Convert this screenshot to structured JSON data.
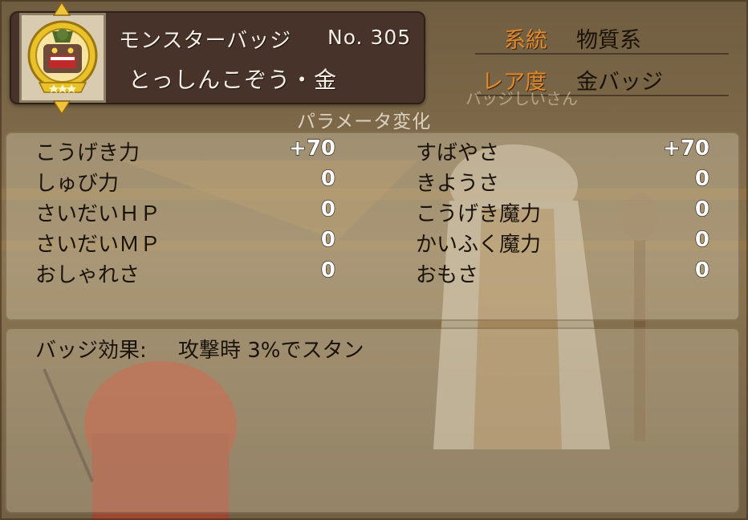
{
  "header": {
    "badge_type": "モンスターバッジ",
    "badge_number": "No. 305",
    "monster_name": "とっしんこぞう・金"
  },
  "info": {
    "lineage_label": "系統",
    "lineage_value": "物質系",
    "rarity_label": "レア度",
    "rarity_value": "金バッジ"
  },
  "background_npc_label": "バッジしいさん",
  "params": {
    "title": "パラメータ変化",
    "left": [
      {
        "name": "こうげき力",
        "value": "+70"
      },
      {
        "name": "しゅび力",
        "value": "0"
      },
      {
        "name": "さいだいＨＰ",
        "value": "0"
      },
      {
        "name": "さいだいＭＰ",
        "value": "0"
      },
      {
        "name": "おしゃれさ",
        "value": "0"
      }
    ],
    "right": [
      {
        "name": "すばやさ",
        "value": "+70"
      },
      {
        "name": "きようさ",
        "value": "0"
      },
      {
        "name": "こうげき魔力",
        "value": "0"
      },
      {
        "name": "かいふく魔力",
        "value": "0"
      },
      {
        "name": "おもさ",
        "value": "0"
      }
    ]
  },
  "effect": {
    "label": "バッジ効果:",
    "text": "攻撃時 3%でスタン"
  },
  "colors": {
    "accent_label": "#e08a2e",
    "header_bg": "#473329",
    "badge_gold": "#e9c22a"
  },
  "icons": {
    "badge": "monster-badge-icon",
    "prev": "arrow-up-icon",
    "next": "arrow-down-icon"
  }
}
